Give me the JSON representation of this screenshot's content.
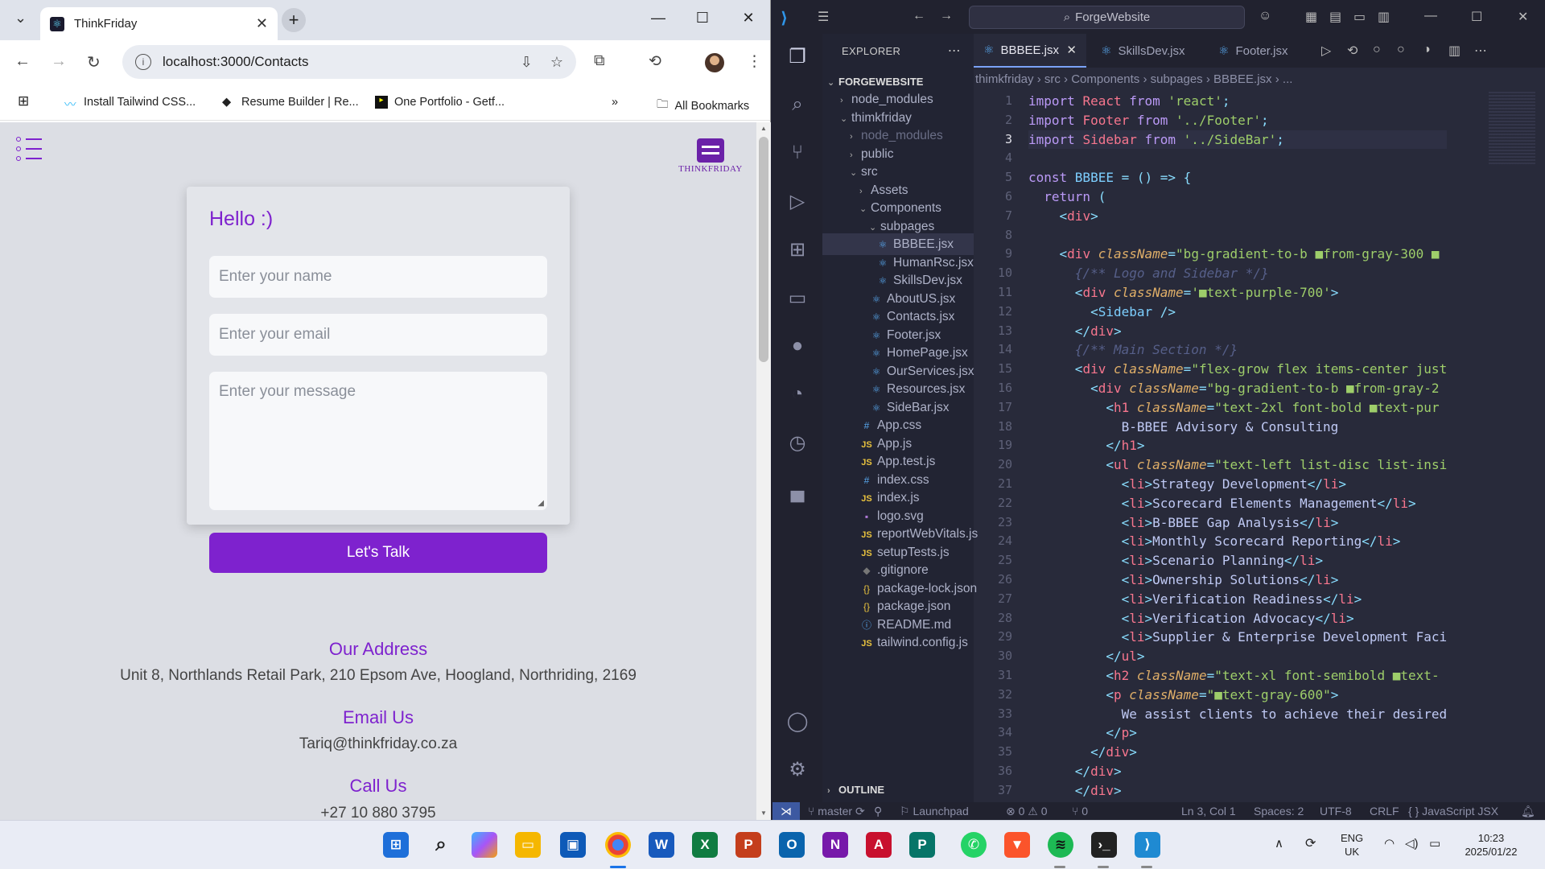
{
  "chrome": {
    "tab_title": "ThinkFriday",
    "url": "localhost:3000/Contacts",
    "bookmarks": [
      "Install Tailwind CSS...",
      "Resume Builder | Re...",
      "One Portfolio - Getf..."
    ],
    "all_bookmarks": "All Bookmarks",
    "more_bookmarks": "»"
  },
  "page": {
    "logo_text": "THINKFRIDAY",
    "greeting": "Hello :)",
    "name_placeholder": "Enter your name",
    "email_placeholder": "Enter your email",
    "message_placeholder": "Enter your message",
    "submit_label": "Let's Talk",
    "address_heading": "Our Address",
    "address": "Unit 8, Northlands Retail Park, 210 Epsom Ave, Hoogland, Northriding, 2169",
    "email_heading": "Email Us",
    "email": "Tariq@thinkfriday.co.za",
    "call_heading": "Call Us",
    "phone": "+27 10 880 3795"
  },
  "vscode": {
    "search": "ForgeWebsite",
    "explorer_title": "EXPLORER",
    "project": "FORGEWEBSITE",
    "outline": "OUTLINE",
    "tree": [
      {
        "label": "node_modules",
        "kind": "folder"
      },
      {
        "label": "thimkfriday",
        "kind": "folder-open"
      },
      {
        "label": "node_modules",
        "kind": "folder-dim"
      },
      {
        "label": "public",
        "kind": "folder"
      },
      {
        "label": "src",
        "kind": "folder-open"
      },
      {
        "label": "Assets",
        "kind": "folder"
      },
      {
        "label": "Components",
        "kind": "folder-open"
      },
      {
        "label": "subpages",
        "kind": "folder-open"
      },
      {
        "label": "BBBEE.jsx",
        "kind": "jsx"
      },
      {
        "label": "HumanRsc.jsx",
        "kind": "jsx"
      },
      {
        "label": "SkillsDev.jsx",
        "kind": "jsx"
      },
      {
        "label": "AboutUS.jsx",
        "kind": "jsx"
      },
      {
        "label": "Contacts.jsx",
        "kind": "jsx"
      },
      {
        "label": "Footer.jsx",
        "kind": "jsx"
      },
      {
        "label": "HomePage.jsx",
        "kind": "jsx"
      },
      {
        "label": "OurServices.jsx",
        "kind": "jsx"
      },
      {
        "label": "Resources.jsx",
        "kind": "jsx"
      },
      {
        "label": "SideBar.jsx",
        "kind": "jsx"
      },
      {
        "label": "App.css",
        "kind": "css"
      },
      {
        "label": "App.js",
        "kind": "js"
      },
      {
        "label": "App.test.js",
        "kind": "js"
      },
      {
        "label": "index.css",
        "kind": "css"
      },
      {
        "label": "index.js",
        "kind": "js"
      },
      {
        "label": "logo.svg",
        "kind": "svg"
      },
      {
        "label": "reportWebVitals.js",
        "kind": "js"
      },
      {
        "label": "setupTests.js",
        "kind": "js"
      },
      {
        "label": ".gitignore",
        "kind": "git"
      },
      {
        "label": "package-lock.json",
        "kind": "json"
      },
      {
        "label": "package.json",
        "kind": "json"
      },
      {
        "label": "README.md",
        "kind": "info"
      },
      {
        "label": "tailwind.config.js",
        "kind": "js"
      }
    ],
    "tabs": [
      "BBBEE.jsx",
      "SkillsDev.jsx",
      "Footer.jsx"
    ],
    "breadcrumb": [
      "thimkfriday",
      "src",
      "Components",
      "subpages",
      "BBBEE.jsx",
      "..."
    ],
    "code": [
      [
        [
          "kw",
          "import "
        ],
        [
          "id",
          "React "
        ],
        [
          "kw",
          "from "
        ],
        [
          "str",
          "'react'"
        ],
        [
          "pn",
          ";"
        ]
      ],
      [
        [
          "kw",
          "import "
        ],
        [
          "id",
          "Footer "
        ],
        [
          "kw",
          "from "
        ],
        [
          "str",
          "'../Footer'"
        ],
        [
          "pn",
          ";"
        ]
      ],
      [
        [
          "kw",
          "import "
        ],
        [
          "id",
          "Sidebar "
        ],
        [
          "kw",
          "from "
        ],
        [
          "str",
          "'../SideBar'"
        ],
        [
          "pn",
          ";"
        ]
      ],
      [],
      [
        [
          "kw",
          "const "
        ],
        [
          "fn",
          "BBBEE "
        ],
        [
          "pn",
          "= () => {"
        ]
      ],
      [
        [
          "tx",
          "  "
        ],
        [
          "kw",
          "return "
        ],
        [
          "pn",
          "("
        ]
      ],
      [
        [
          "tx",
          "    "
        ],
        [
          "pn",
          "<"
        ],
        [
          "tag",
          "div"
        ],
        [
          "pn",
          ">"
        ]
      ],
      [],
      [
        [
          "tx",
          "    "
        ],
        [
          "pn",
          "<"
        ],
        [
          "tag",
          "div "
        ],
        [
          "attr",
          "className"
        ],
        [
          "pn",
          "="
        ],
        [
          "str",
          "\"bg-gradient-to-b ■from-gray-300 ■"
        ]
      ],
      [
        [
          "tx",
          "      "
        ],
        [
          "cm",
          "{/** Logo and Sidebar */}"
        ]
      ],
      [
        [
          "tx",
          "      "
        ],
        [
          "pn",
          "<"
        ],
        [
          "tag",
          "div "
        ],
        [
          "attr",
          "className"
        ],
        [
          "pn",
          "="
        ],
        [
          "str",
          "'■text-purple-700'"
        ],
        [
          "pn",
          ">"
        ]
      ],
      [
        [
          "tx",
          "        "
        ],
        [
          "pn",
          "<"
        ],
        [
          "fn",
          "Sidebar "
        ],
        [
          "pn",
          "/>"
        ]
      ],
      [
        [
          "tx",
          "      "
        ],
        [
          "pn",
          "</"
        ],
        [
          "tag",
          "div"
        ],
        [
          "pn",
          ">"
        ]
      ],
      [
        [
          "tx",
          "      "
        ],
        [
          "cm",
          "{/** Main Section */}"
        ]
      ],
      [
        [
          "tx",
          "      "
        ],
        [
          "pn",
          "<"
        ],
        [
          "tag",
          "div "
        ],
        [
          "attr",
          "className"
        ],
        [
          "pn",
          "="
        ],
        [
          "str",
          "\"flex-grow flex items-center just"
        ]
      ],
      [
        [
          "tx",
          "        "
        ],
        [
          "pn",
          "<"
        ],
        [
          "tag",
          "div "
        ],
        [
          "attr",
          "className"
        ],
        [
          "pn",
          "="
        ],
        [
          "str",
          "\"bg-gradient-to-b ■from-gray-2"
        ]
      ],
      [
        [
          "tx",
          "          "
        ],
        [
          "pn",
          "<"
        ],
        [
          "tag",
          "h1 "
        ],
        [
          "attr",
          "className"
        ],
        [
          "pn",
          "="
        ],
        [
          "str",
          "\"text-2xl font-bold ■text-pur"
        ]
      ],
      [
        [
          "tx",
          "            B-BBEE Advisory & Consulting"
        ]
      ],
      [
        [
          "tx",
          "          "
        ],
        [
          "pn",
          "</"
        ],
        [
          "tag",
          "h1"
        ],
        [
          "pn",
          ">"
        ]
      ],
      [
        [
          "tx",
          "          "
        ],
        [
          "pn",
          "<"
        ],
        [
          "tag",
          "ul "
        ],
        [
          "attr",
          "className"
        ],
        [
          "pn",
          "="
        ],
        [
          "str",
          "\"text-left list-disc list-insi"
        ]
      ],
      [
        [
          "tx",
          "            "
        ],
        [
          "pn",
          "<"
        ],
        [
          "tag",
          "li"
        ],
        [
          "pn",
          ">"
        ],
        [
          "tx",
          "Strategy Development"
        ],
        [
          "pn",
          "</"
        ],
        [
          "tag",
          "li"
        ],
        [
          "pn",
          ">"
        ]
      ],
      [
        [
          "tx",
          "            "
        ],
        [
          "pn",
          "<"
        ],
        [
          "tag",
          "li"
        ],
        [
          "pn",
          ">"
        ],
        [
          "tx",
          "Scorecard Elements Management"
        ],
        [
          "pn",
          "</"
        ],
        [
          "tag",
          "li"
        ],
        [
          "pn",
          ">"
        ]
      ],
      [
        [
          "tx",
          "            "
        ],
        [
          "pn",
          "<"
        ],
        [
          "tag",
          "li"
        ],
        [
          "pn",
          ">"
        ],
        [
          "tx",
          "B-BBEE Gap Analysis"
        ],
        [
          "pn",
          "</"
        ],
        [
          "tag",
          "li"
        ],
        [
          "pn",
          ">"
        ]
      ],
      [
        [
          "tx",
          "            "
        ],
        [
          "pn",
          "<"
        ],
        [
          "tag",
          "li"
        ],
        [
          "pn",
          ">"
        ],
        [
          "tx",
          "Monthly Scorecard Reporting"
        ],
        [
          "pn",
          "</"
        ],
        [
          "tag",
          "li"
        ],
        [
          "pn",
          ">"
        ]
      ],
      [
        [
          "tx",
          "            "
        ],
        [
          "pn",
          "<"
        ],
        [
          "tag",
          "li"
        ],
        [
          "pn",
          ">"
        ],
        [
          "tx",
          "Scenario Planning"
        ],
        [
          "pn",
          "</"
        ],
        [
          "tag",
          "li"
        ],
        [
          "pn",
          ">"
        ]
      ],
      [
        [
          "tx",
          "            "
        ],
        [
          "pn",
          "<"
        ],
        [
          "tag",
          "li"
        ],
        [
          "pn",
          ">"
        ],
        [
          "tx",
          "Ownership Solutions"
        ],
        [
          "pn",
          "</"
        ],
        [
          "tag",
          "li"
        ],
        [
          "pn",
          ">"
        ]
      ],
      [
        [
          "tx",
          "            "
        ],
        [
          "pn",
          "<"
        ],
        [
          "tag",
          "li"
        ],
        [
          "pn",
          ">"
        ],
        [
          "tx",
          "Verification Readiness"
        ],
        [
          "pn",
          "</"
        ],
        [
          "tag",
          "li"
        ],
        [
          "pn",
          ">"
        ]
      ],
      [
        [
          "tx",
          "            "
        ],
        [
          "pn",
          "<"
        ],
        [
          "tag",
          "li"
        ],
        [
          "pn",
          ">"
        ],
        [
          "tx",
          "Verification Advocacy"
        ],
        [
          "pn",
          "</"
        ],
        [
          "tag",
          "li"
        ],
        [
          "pn",
          ">"
        ]
      ],
      [
        [
          "tx",
          "            "
        ],
        [
          "pn",
          "<"
        ],
        [
          "tag",
          "li"
        ],
        [
          "pn",
          ">"
        ],
        [
          "tx",
          "Supplier & Enterprise Development Faci"
        ]
      ],
      [
        [
          "tx",
          "          "
        ],
        [
          "pn",
          "</"
        ],
        [
          "tag",
          "ul"
        ],
        [
          "pn",
          ">"
        ]
      ],
      [
        [
          "tx",
          "          "
        ],
        [
          "pn",
          "<"
        ],
        [
          "tag",
          "h2 "
        ],
        [
          "attr",
          "className"
        ],
        [
          "pn",
          "="
        ],
        [
          "str",
          "\"text-xl font-semibold ■text-"
        ]
      ],
      [
        [
          "tx",
          "          "
        ],
        [
          "pn",
          "<"
        ],
        [
          "tag",
          "p "
        ],
        [
          "attr",
          "className"
        ],
        [
          "pn",
          "="
        ],
        [
          "str",
          "\"■text-gray-600\""
        ],
        [
          "pn",
          ">"
        ]
      ],
      [
        [
          "tx",
          "            We assist clients to achieve their desired"
        ]
      ],
      [
        [
          "tx",
          "          "
        ],
        [
          "pn",
          "</"
        ],
        [
          "tag",
          "p"
        ],
        [
          "pn",
          ">"
        ]
      ],
      [
        [
          "tx",
          "        "
        ],
        [
          "pn",
          "</"
        ],
        [
          "tag",
          "div"
        ],
        [
          "pn",
          ">"
        ]
      ],
      [
        [
          "tx",
          "      "
        ],
        [
          "pn",
          "</"
        ],
        [
          "tag",
          "div"
        ],
        [
          "pn",
          ">"
        ]
      ],
      [
        [
          "tx",
          "      "
        ],
        [
          "pn",
          "</"
        ],
        [
          "tag",
          "div"
        ],
        [
          "pn",
          ">"
        ]
      ]
    ],
    "current_line": 3,
    "status": {
      "branch": "master",
      "launchpad": "Launchpad",
      "problems": "⊗ 0 ⚠ 0",
      "ports": "⑂ 0",
      "position": "Ln 3, Col 1",
      "spaces": "Spaces: 2",
      "encoding": "UTF-8",
      "eol": "CRLF",
      "language": "{ } JavaScript JSX"
    }
  },
  "taskbar": {
    "lang": "ENG",
    "region": "UK",
    "time": "10:23",
    "date": "2025/01/22"
  },
  "colors": {
    "accent": "#7e22ce",
    "vscode_bg": "#282a3a"
  }
}
